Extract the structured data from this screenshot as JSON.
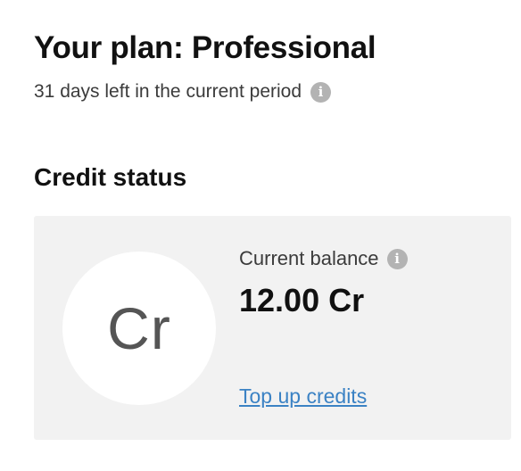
{
  "plan": {
    "title": "Your plan: Professional",
    "period_text": "31 days left in the current period",
    "info_icon": "i"
  },
  "credit_status": {
    "title": "Credit status",
    "badge_text": "Cr",
    "balance_label": "Current balance",
    "balance_info_icon": "i",
    "balance_value": "12.00 Cr",
    "topup_label": "Top up credits"
  },
  "colors": {
    "card_background": "#f2f2f2",
    "link": "#3b82c4",
    "info_icon": "#b3b3b3"
  }
}
